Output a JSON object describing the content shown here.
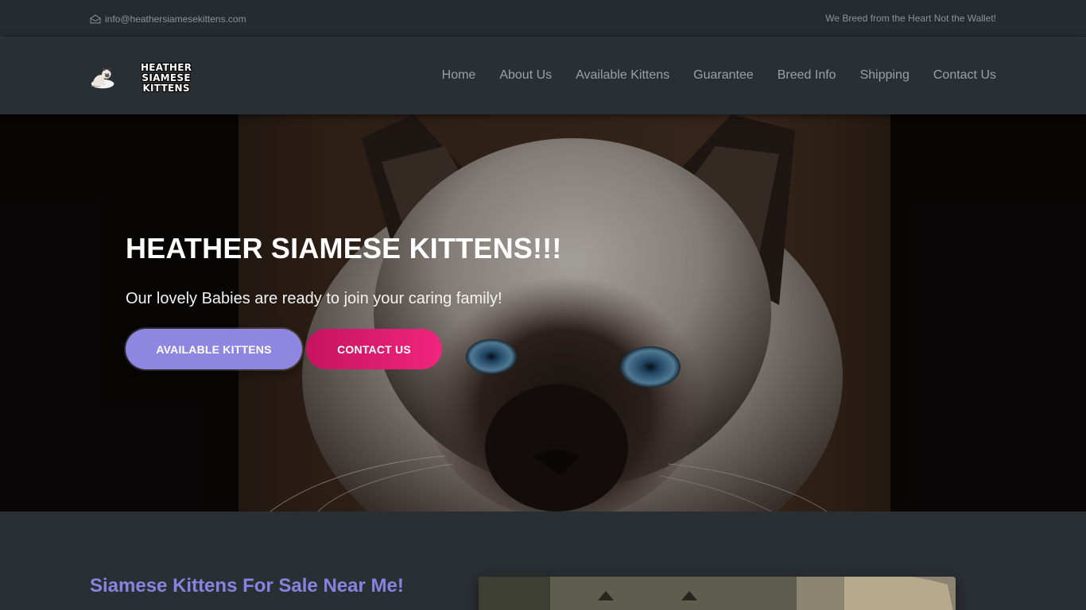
{
  "topbar": {
    "email": "info@heathersiamesekittens.com",
    "tagline": "We Breed from the Heart Not the Wallet!"
  },
  "brand": {
    "line1": "HEATHER SIAMESE",
    "line2": "KITTENS"
  },
  "nav": {
    "items": [
      "Home",
      "About Us",
      "Available Kittens",
      "Guarantee",
      "Breed Info",
      "Shipping",
      "Contact Us"
    ]
  },
  "hero": {
    "title": "HEATHER SIAMESE KITTENS!!!",
    "subtitle": "Our lovely Babies are ready to join your caring family!",
    "primary_button": "AVAILABLE KITTENS",
    "secondary_button": "CONTACT US"
  },
  "section": {
    "title": "Siamese Kittens For Sale Near Me!"
  },
  "colors": {
    "accent_purple": "#8e86e0",
    "accent_pink": "#e11d74",
    "background": "#2a2f33"
  },
  "icons": {
    "email": "envelope-icon",
    "logo": "cat-logo-icon"
  }
}
